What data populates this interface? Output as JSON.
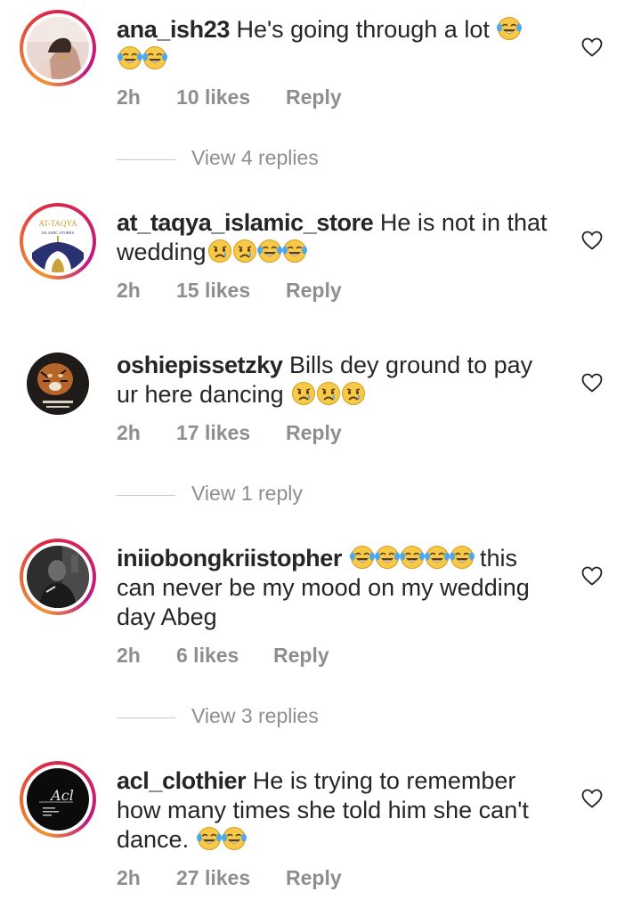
{
  "comments": [
    {
      "username": "ana_ish23",
      "text": "He's going through a lot",
      "emojis_after": "😂😂😂",
      "time": "2h",
      "likes": "10 likes",
      "reply": "Reply",
      "view_replies": "View 4 replies",
      "avatar": "woman-portrait-avatar",
      "has_story_ring": true
    },
    {
      "username": "at_taqya_islamic_store",
      "text": "He is not in that wedding",
      "emojis_after": "😢😢😂😂",
      "time": "2h",
      "likes": "15 likes",
      "reply": "Reply",
      "avatar_text_top": "AT-TAQYA",
      "avatar_text_sub": "ISLAMIC STORES",
      "avatar": "mosque-logo-avatar",
      "has_story_ring": true
    },
    {
      "username": "oshiepissetzky",
      "text": "Bills dey ground to pay ur here dancing",
      "emojis_after": "😢😢😢",
      "time": "2h",
      "likes": "17 likes",
      "reply": "Reply",
      "view_replies": "View 1 reply",
      "avatar": "tiger-avatar",
      "has_story_ring": false
    },
    {
      "username": "iniiobongkriistopher",
      "emojis_before": "😂😂😂😂😂",
      "text": "this can never be my mood on my wedding day Abeg",
      "time": "2h",
      "likes": "6 likes",
      "reply": "Reply",
      "view_replies": "View 3 replies",
      "avatar": "man-photo-avatar",
      "has_story_ring": true
    },
    {
      "username": "acl_clothier",
      "text": "He is trying to remember how many times she told him she can't dance.",
      "emojis_after": "😂😂",
      "time": "2h",
      "likes": "27 likes",
      "reply": "Reply",
      "avatar_text": "Acl",
      "avatar": "acl-logo-avatar",
      "has_story_ring": true
    }
  ],
  "colors": {
    "text": "#262626",
    "meta": "#8e8e8e",
    "story_ring": [
      "#f09433",
      "#dc2743",
      "#bc1888"
    ]
  },
  "icons": {
    "like": "heart-outline-icon",
    "laugh": "face-with-tears-of-joy-emoji",
    "cry": "crying-face-emoji"
  }
}
